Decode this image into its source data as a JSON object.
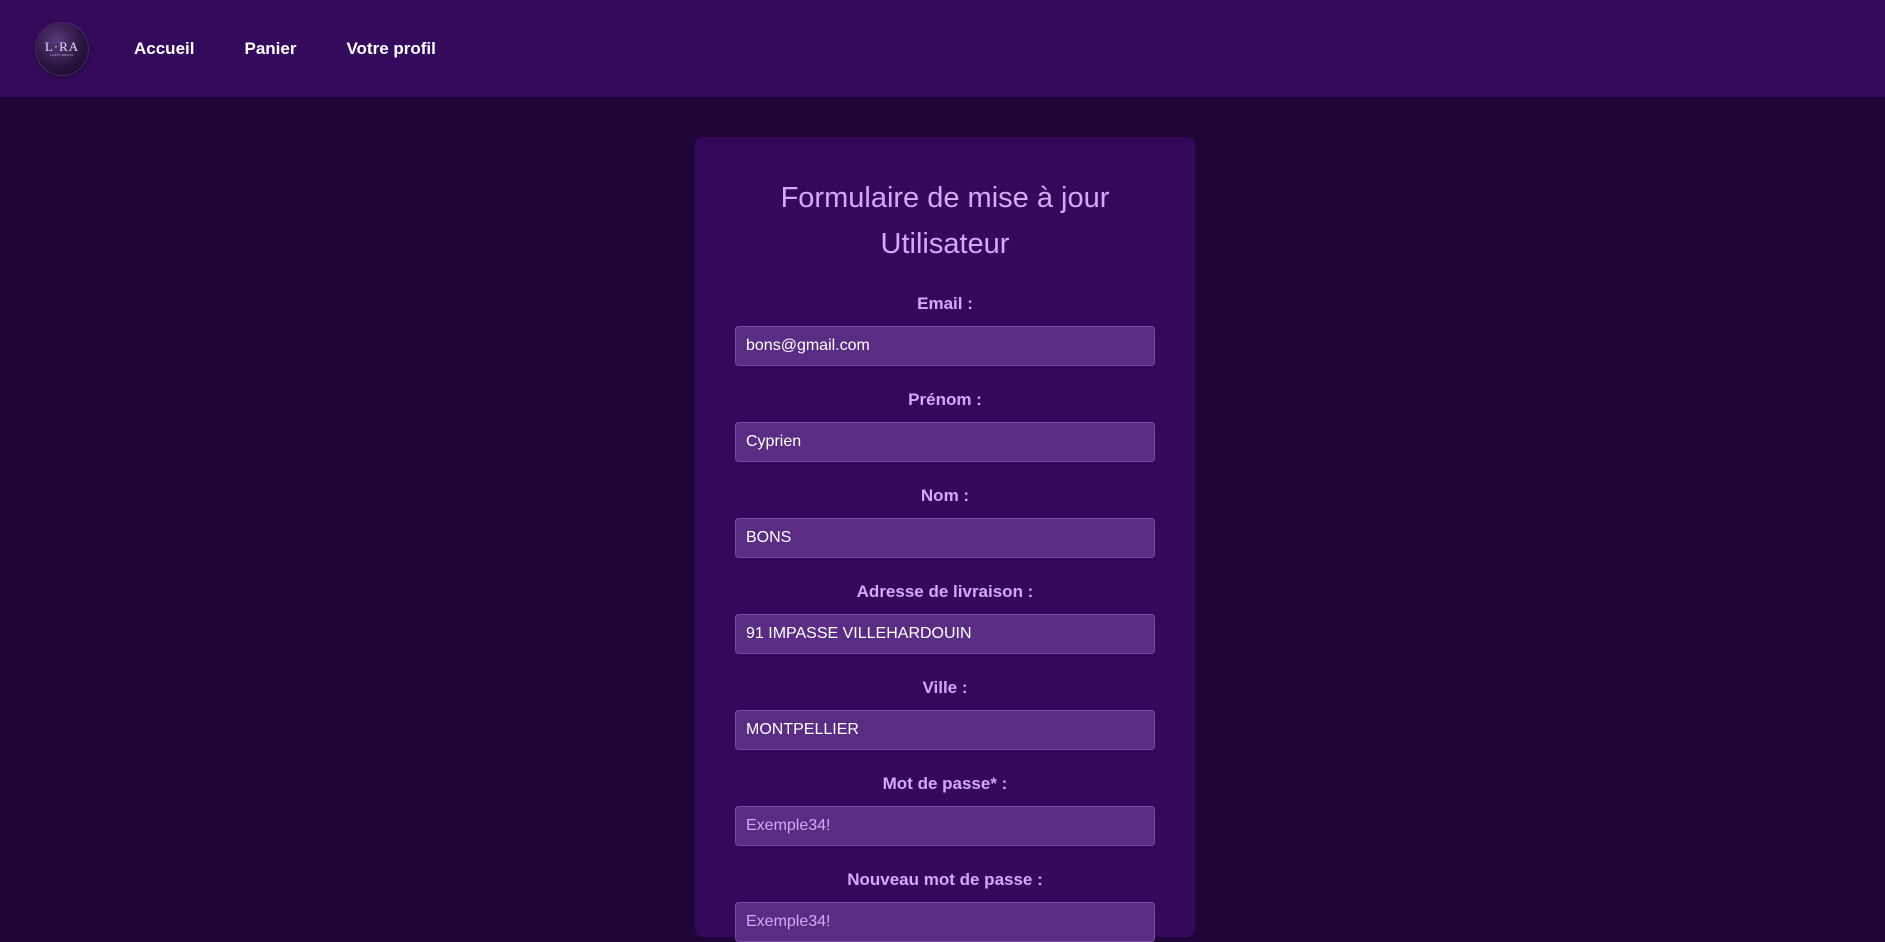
{
  "nav": {
    "logo_text": "L·RA",
    "logo_subtext": "PARFUMERIE",
    "links": [
      {
        "label": "Accueil"
      },
      {
        "label": "Panier"
      },
      {
        "label": "Votre profil"
      }
    ]
  },
  "form": {
    "title": "Formulaire de mise à jour Utilisateur",
    "fields": [
      {
        "label": "Email :",
        "value": "bons@gmail.com",
        "placeholder": ""
      },
      {
        "label": "Prénom :",
        "value": "Cyprien",
        "placeholder": ""
      },
      {
        "label": "Nom :",
        "value": "BONS",
        "placeholder": ""
      },
      {
        "label": "Adresse de livraison :",
        "value": "91 IMPASSE VILLEHARDOUIN",
        "placeholder": ""
      },
      {
        "label": "Ville :",
        "value": "MONTPELLIER",
        "placeholder": ""
      },
      {
        "label": "Mot de passe* :",
        "value": "",
        "placeholder": "Exemple34!"
      },
      {
        "label": "Nouveau mot de passe :",
        "value": "",
        "placeholder": "Exemple34!"
      }
    ]
  },
  "colors": {
    "page_background": "#1e0538",
    "navbar_background": "#340b5c",
    "card_background": "#34095b",
    "input_background": "#5b2c83",
    "accent_text": "#d6a8f5"
  }
}
